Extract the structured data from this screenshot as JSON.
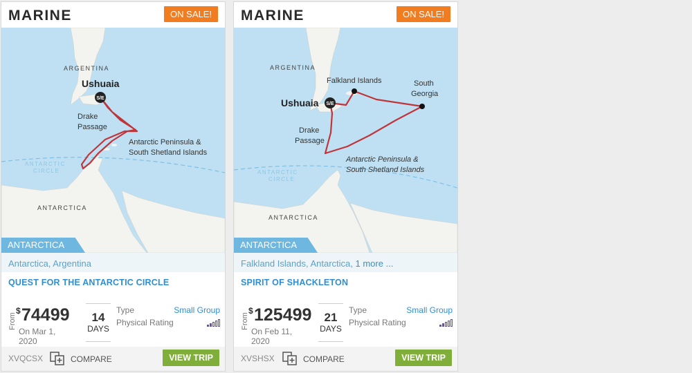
{
  "cards": [
    {
      "brand": "MARINE",
      "sale_badge": "ON SALE!",
      "map": {
        "country": "ARGENTINA",
        "continent": "ANTARCTICA",
        "port": "Ushuaia",
        "port_marker": "S/E",
        "passage": [
          "Drake",
          "Passage"
        ],
        "destination": [
          "Antarctic Peninsula &",
          "South Shetland Islands"
        ],
        "circle": [
          "ANTARCTIC",
          "CIRCLE"
        ]
      },
      "region": "ANTARCTICA",
      "locations": "Antarctica, Argentina",
      "locations_more": "",
      "title": "QUEST FOR THE ANTARCTIC CIRCLE",
      "from_label": "From",
      "currency": "$",
      "price": "74499",
      "date": "On Mar 1, 2020",
      "days_num": "14",
      "days_label": "DAYS",
      "type_label": "Type",
      "type_value": "Small Group",
      "rating_label": "Physical Rating",
      "rating_level": 2,
      "rating_max": 5,
      "code": "XVQCSX",
      "compare_label": "COMPARE",
      "view_label": "VIEW TRIP"
    },
    {
      "brand": "MARINE",
      "sale_badge": "ON SALE!",
      "map": {
        "country": "ARGENTINA",
        "continent": "ANTARCTICA",
        "port": "Ushuaia",
        "port_marker": "S/E",
        "passage": [
          "Drake",
          "Passage"
        ],
        "destination": [
          "Antarctic Peninsula &",
          "South Shetland Islands"
        ],
        "circle": [
          "ANTARCTIC",
          "CIRCLE"
        ],
        "falklands": "Falkland Islands",
        "south_georgia": [
          "South",
          "Georgia"
        ]
      },
      "region": "ANTARCTICA",
      "locations": "Falkland Islands, Antarctica, ",
      "locations_more": "1 more ...",
      "title": "SPIRIT OF SHACKLETON",
      "from_label": "From",
      "currency": "$",
      "price": "125499",
      "date": "On Feb 11, 2020",
      "days_num": "21",
      "days_label": "DAYS",
      "type_label": "Type",
      "type_value": "Small Group",
      "rating_label": "Physical Rating",
      "rating_level": 2,
      "rating_max": 5,
      "code": "XVSHSX",
      "compare_label": "COMPARE",
      "view_label": "VIEW TRIP"
    }
  ],
  "colors": {
    "sea": "#bfe0f2",
    "land": "#f3f3ef",
    "route": "#c0343a",
    "sale": "#f27d21",
    "region_tab": "#6db7e0",
    "view_button": "#7fae3a",
    "link": "#2f8ed2"
  }
}
